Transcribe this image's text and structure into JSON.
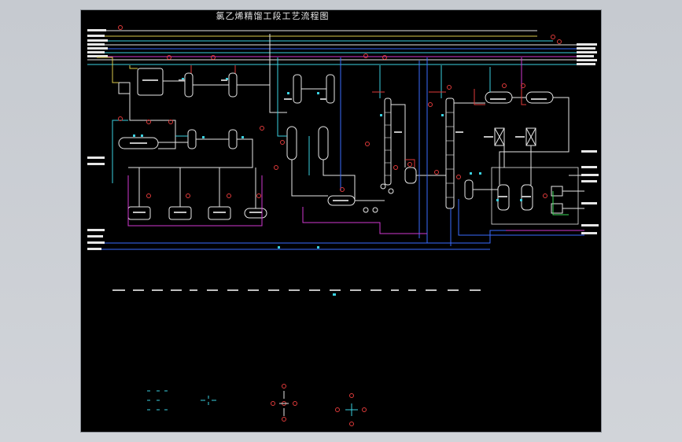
{
  "drawing": {
    "title": "氯乙烯精馏工段工艺流程图"
  },
  "colors": {
    "background": "#000000",
    "viewport": "#c9cdd3",
    "line_white": "#e6e6e6",
    "line_yellow": "#d8c84a",
    "line_cyan": "#3ad0e0",
    "line_blue": "#3a6cff",
    "line_magenta": "#d038d0",
    "line_red": "#e03a3a",
    "line_green": "#3adc58",
    "equipment": "#e8e8e8"
  },
  "icons": {
    "instrument_bubble": "red-circle-icon",
    "valve": "valve-icon",
    "pump": "pump-icon"
  }
}
